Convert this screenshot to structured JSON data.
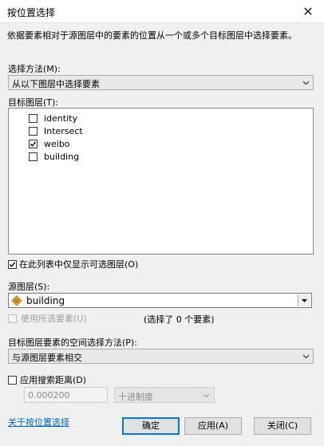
{
  "window": {
    "title": "按位置选择"
  },
  "description": "依据要素相对于源图层中的要素的位置从一个或多个目标图层中选择要素。",
  "selection_method": {
    "label": "选择方法(M):",
    "value": "从以下图层中选择要素"
  },
  "target_layers": {
    "label": "目标图层(T):",
    "items": [
      {
        "name": "identity",
        "checked": false
      },
      {
        "name": "Intersect",
        "checked": false
      },
      {
        "name": "weibo",
        "checked": true
      },
      {
        "name": "building",
        "checked": false
      }
    ]
  },
  "only_selectable": {
    "label": "在此列表中仅显示可选图层(O)",
    "checked": true
  },
  "source_layer": {
    "label": "源图层(S):",
    "value": "building"
  },
  "use_selected": {
    "label": "使用所选要素(U)",
    "checked": false,
    "count_text": "(选择了 0 个要素)"
  },
  "spatial_method": {
    "label": "目标图层要素的空间选择方法(P):",
    "value": "与源图层要素相交"
  },
  "search_distance": {
    "label": "应用搜索距离(D)",
    "checked": false,
    "value": "0.000200",
    "unit": "十进制度"
  },
  "footer": {
    "link": "关于按位置选择",
    "ok": "确定",
    "apply": "应用(A)",
    "close": "关闭(C)"
  }
}
